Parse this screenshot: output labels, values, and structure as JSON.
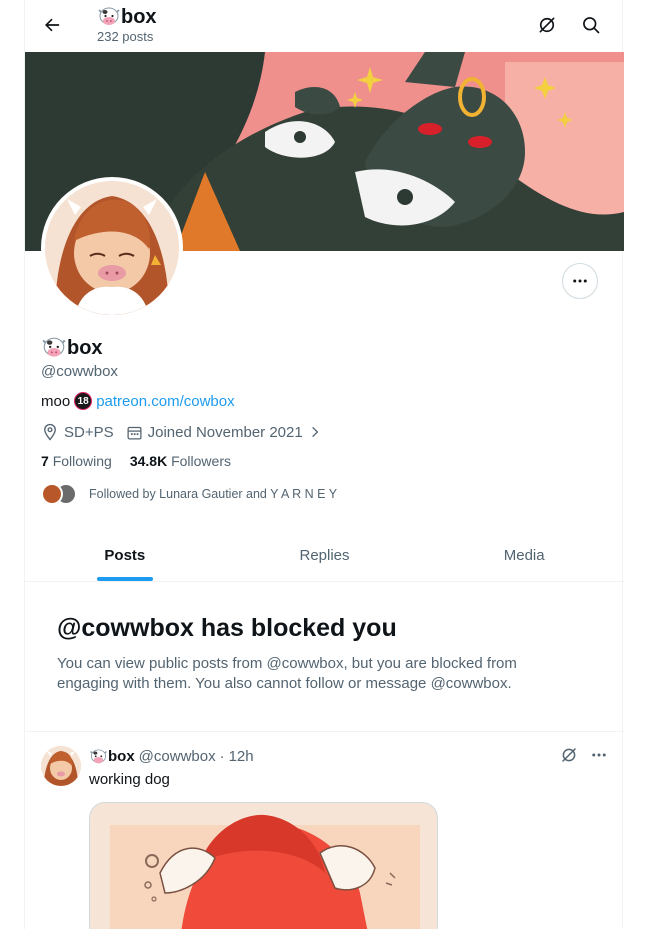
{
  "header": {
    "title": "box",
    "post_count": "232 posts"
  },
  "profile": {
    "display_name": "box",
    "handle": "@cowwbox",
    "bio_text": "moo",
    "bio_badge": "18",
    "bio_link": "patreon.com/cowbox",
    "location": "SD+PS",
    "joined": "Joined November 2021",
    "following_count": "7",
    "following_label": "Following",
    "followers_count": "34.8K",
    "followers_label": "Followers",
    "followed_by": "Followed by Lunara Gautier and Y A R N E Y"
  },
  "tabs": [
    {
      "label": "Posts",
      "active": true
    },
    {
      "label": "Replies",
      "active": false
    },
    {
      "label": "Media",
      "active": false
    }
  ],
  "blocked_notice": {
    "title": "@cowwbox has blocked you",
    "body": "You can view public posts from @cowwbox, but you are blocked from engaging with them. You also cannot follow or message @cowwbox."
  },
  "post": {
    "author": "box",
    "handle": "@cowwbox",
    "separator": "·",
    "time": "12h",
    "text": "working dog"
  },
  "colors": {
    "accent": "#1d9bf0",
    "text_primary": "#0f1419",
    "text_secondary": "#536471",
    "banner_bg": "#f08c8c"
  },
  "icons": [
    "back-arrow-icon",
    "grok-icon",
    "search-icon",
    "more-icon",
    "location-icon",
    "calendar-icon",
    "chevron-right-icon",
    "cow-emoji-icon"
  ]
}
